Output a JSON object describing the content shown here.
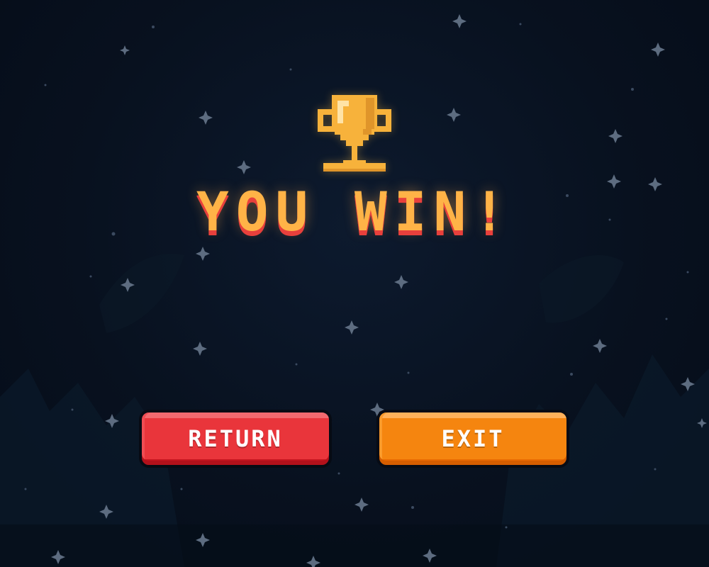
{
  "screen": {
    "headline": "YOU WIN!",
    "trophy_icon": "trophy-icon",
    "colors": {
      "background": "#071223",
      "headline_fill": "#ffb347",
      "headline_shadow": "#e8403c",
      "return_button": "#e9353b",
      "exit_button": "#f5850f",
      "trophy_gold": "#f7b23b"
    }
  },
  "buttons": {
    "return_label": "RETURN",
    "exit_label": "EXIT"
  }
}
